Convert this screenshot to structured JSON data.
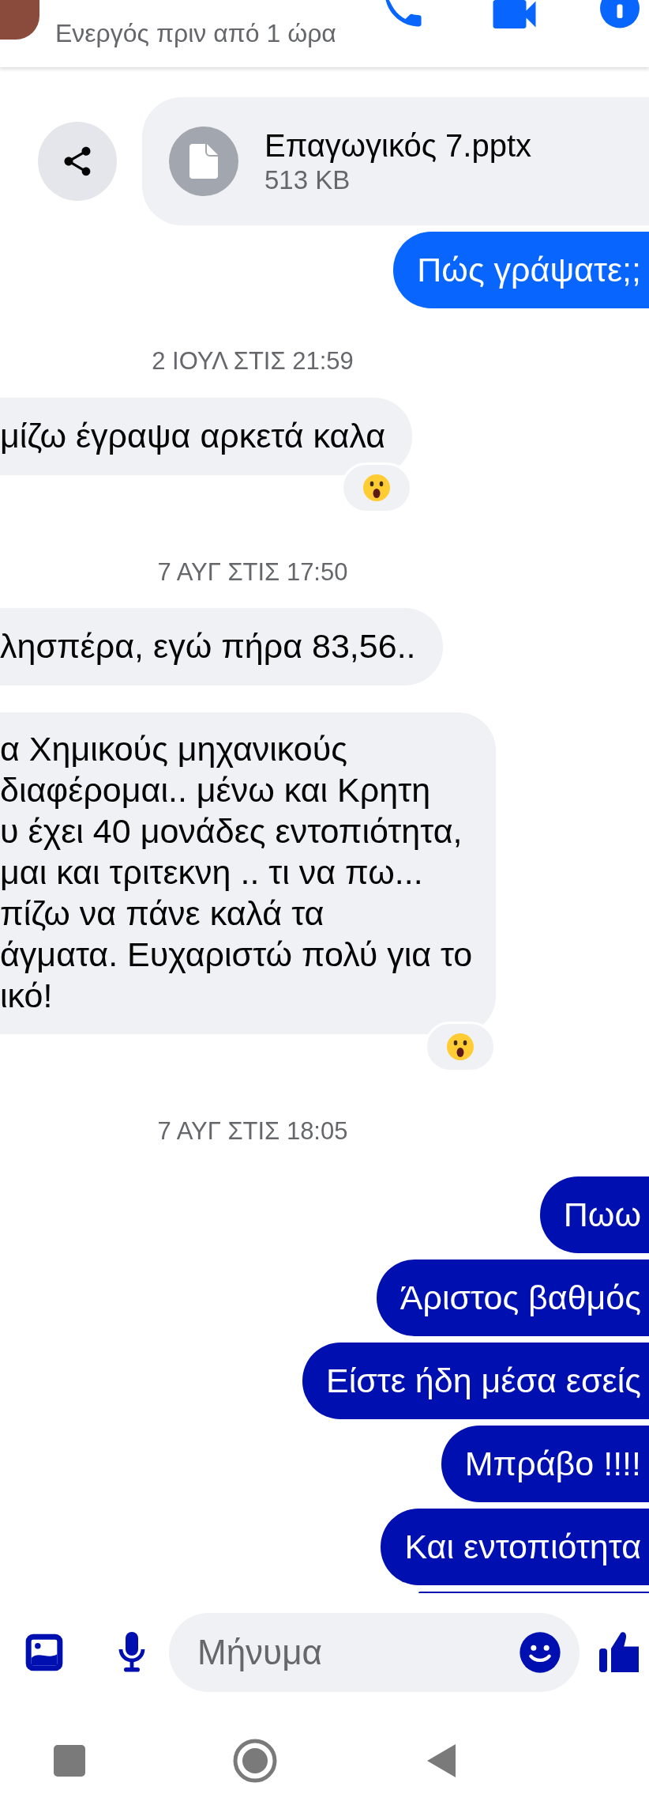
{
  "header": {
    "status": "Ενεργός πριν από 1 ώρα"
  },
  "messages": [
    {
      "kind": "file",
      "file_name": "Επαγωγικός 7.pptx",
      "size": "513 KB"
    },
    {
      "kind": "sent",
      "text": "Πώς γράψατε;;",
      "color": "#0866ff"
    },
    {
      "kind": "timestamp",
      "text": "2 ΙΟΥΛ ΣΤΙΣ 21:59"
    },
    {
      "kind": "received",
      "text": "μίζω έγραψα αρκετά καλα",
      "reaction": true
    },
    {
      "kind": "timestamp",
      "text": "7 ΑΥΓ ΣΤΙΣ 17:50"
    },
    {
      "kind": "received",
      "text": "λησπέρα, εγώ πήρα 83,56..",
      "reaction": false
    },
    {
      "kind": "received",
      "text": "α Χημικούς μηχανικούς\nδιαφέρομαι.. μένω και Κρητη\nυ έχει 40 μονάδες εντοπιότητα,\nμαι και τριτεκνη .. τι να πω...\nπίζω να πάνε καλά τα\nάγματα. Ευχαριστώ πολύ για το\nικό!",
      "reaction": true
    },
    {
      "kind": "timestamp",
      "text": "7 ΑΥΓ ΣΤΙΣ 18:05"
    },
    {
      "kind": "sent",
      "text": "Πωω",
      "color": "#0010b0"
    },
    {
      "kind": "sent",
      "text": "Άριστος βαθμός",
      "color": "#0010b0"
    },
    {
      "kind": "sent",
      "text": "Είστε ήδη μέσα εσείς",
      "color": "#0010b0"
    },
    {
      "kind": "sent",
      "text": "Μπράβο !!!!",
      "color": "#0010b0"
    },
    {
      "kind": "sent",
      "text": "Και εντοπιότητα",
      "color": "#0010b0"
    },
    {
      "kind": "sent_partial",
      "color": "#0010b0"
    }
  ],
  "composer": {
    "placeholder": "Μήνυμα"
  }
}
